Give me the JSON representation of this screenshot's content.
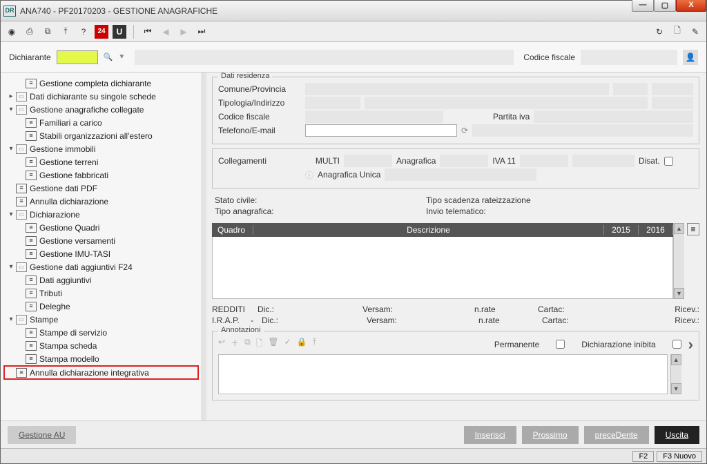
{
  "title": "ANA740 - PF20170203 - GESTIONE ANAGRAFICHE",
  "appicon": "DR",
  "winctrl": {
    "min": "—",
    "max": "▢",
    "close": "X"
  },
  "toolbar": {
    "i24": "24",
    "iU": "U"
  },
  "search": {
    "label": "Dichiarante",
    "cf_label": "Codice fiscale"
  },
  "tree": {
    "n0": "Gestione completa dichiarante",
    "n1": "Dati dichiarante su singole schede",
    "n2": "Gestione anagrafiche collegate",
    "n2a": "Familiari a carico",
    "n2b": "Stabili organizzazioni all'estero",
    "n3": "Gestione immobili",
    "n3a": "Gestione terreni",
    "n3b": "Gestione fabbricati",
    "n4": "Gestione dati PDF",
    "n5": "Annulla dichiarazione",
    "n6": "Dichiarazione",
    "n6a": "Gestione Quadri",
    "n6b": "Gestione versamenti",
    "n6c": "Gestione IMU-TASI",
    "n7": "Gestione dati aggiuntivi F24",
    "n7a": "Dati aggiuntivi",
    "n7b": "Tributi",
    "n7c": "Deleghe",
    "n8": "Stampe",
    "n8a": "Stampe di servizio",
    "n8b": "Stampa scheda",
    "n8c": "Stampa modello",
    "n9": "Annulla dichiarazione integrativa"
  },
  "res": {
    "legend": "Dati residenza",
    "comune": "Comune/Provincia",
    "tipologia": "Tipologia/Indirizzo",
    "cf": "Codice fiscale",
    "piva": "Partita iva",
    "tel": "Telefono/E-mail"
  },
  "coll": {
    "label": "Collegamenti",
    "multi": "MULTI",
    "anag": "Anagrafica",
    "iva": "IVA 11",
    "disat": "Disat.",
    "au": "Anagrafica Unica"
  },
  "stato": {
    "sc": "Stato civile:",
    "tr": "Tipo scadenza rateizzazione",
    "ta": "Tipo anagrafica:",
    "it": "Invio telematico:"
  },
  "table": {
    "quadro": "Quadro",
    "descr": "Descrizione",
    "y15": "2015",
    "y16": "2016"
  },
  "blk": {
    "redditi": "REDDITI",
    "dic": "Dic.:",
    "vers": "Versam:",
    "nrate": "n.rate",
    "cartac": "Cartac:",
    "ricev": "Ricev.:",
    "irap": "I.R.A.P.",
    "dash": "-"
  },
  "ann": {
    "legend": "Annotazioni",
    "perm": "Permanente",
    "inib": "Dichiarazione inibita"
  },
  "footer": {
    "gau": "Gestione AU",
    "ins": "Inserisci",
    "pross": "Prossimo",
    "prec": "preceDente",
    "usc": "Uscita",
    "f2": "F2",
    "f3": "F3 Nuovo"
  }
}
